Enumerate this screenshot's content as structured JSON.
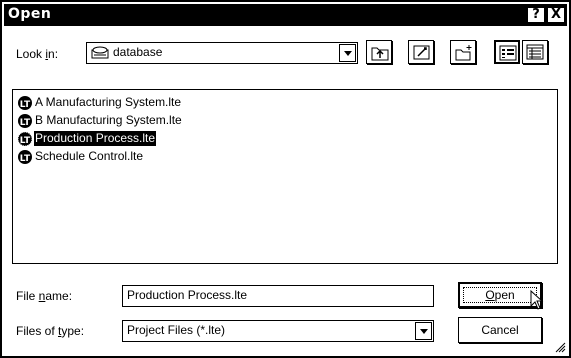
{
  "window": {
    "title": "Open",
    "help_glyph": "?",
    "close_glyph": "X"
  },
  "look_in": {
    "label_pre": "Look ",
    "label_u": "i",
    "label_post": "n:",
    "value": "database"
  },
  "toolbar": {
    "icons": [
      "up-folder-icon",
      "desktop-icon",
      "new-folder-icon",
      "list-view-icon",
      "details-view-icon"
    ]
  },
  "files": [
    {
      "name": "A Manufacturing System.lte",
      "selected": false,
      "icon": "lt-file-icon"
    },
    {
      "name": "B Manufacturing System.lte",
      "selected": false,
      "icon": "lt-file-icon"
    },
    {
      "name": "Production Process.lte",
      "selected": true,
      "icon": "lt-file-icon"
    },
    {
      "name": "Schedule Control.lte",
      "selected": false,
      "icon": "lt-file-icon"
    }
  ],
  "file_name": {
    "label_pre": "File ",
    "label_u": "n",
    "label_post": "ame:",
    "value": "Production Process.lte"
  },
  "file_type": {
    "label_pre": "Files of ",
    "label_u": "t",
    "label_post": "ype:",
    "value": "Project Files (*.lte)"
  },
  "buttons": {
    "open_u": "O",
    "open_rest": "pen",
    "cancel": "Cancel"
  }
}
